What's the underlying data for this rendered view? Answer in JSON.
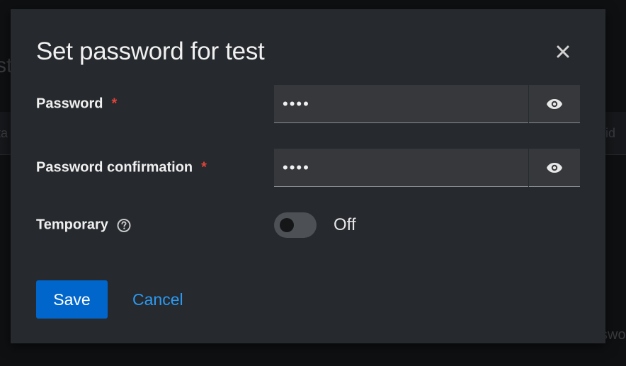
{
  "background": {
    "title_fragment": "st",
    "tab_fragment_left": "ta",
    "tab_fragment_right": "vid",
    "bottom_fragment_right": "swo"
  },
  "modal": {
    "title": "Set password for test",
    "close_icon": "close-icon",
    "fields": {
      "password": {
        "label": "Password",
        "required_marker": "*",
        "value": "••••",
        "toggle_icon": "eye-icon"
      },
      "password_confirmation": {
        "label": "Password confirmation",
        "required_marker": "*",
        "value": "••••",
        "toggle_icon": "eye-icon"
      },
      "temporary": {
        "label": "Temporary",
        "help_icon": "help-icon",
        "state": "Off"
      }
    },
    "actions": {
      "save_label": "Save",
      "cancel_label": "Cancel"
    }
  },
  "colors": {
    "primary_button": "#0066cc",
    "link": "#2b9af3",
    "required": "#e0443b",
    "modal_bg": "#26292d"
  }
}
